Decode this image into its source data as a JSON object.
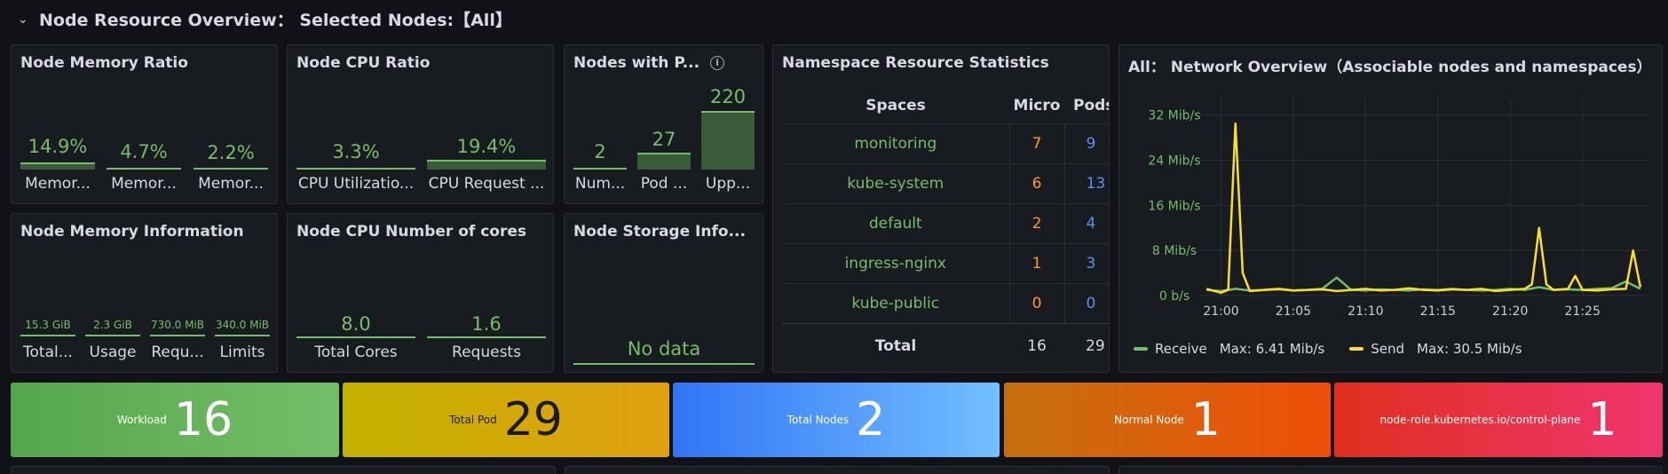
{
  "row": {
    "title": "Node Resource Overview： Selected Nodes:【All】"
  },
  "mem_ratio": {
    "title": "Node Memory Ratio",
    "gauges": [
      {
        "value": "14.9%",
        "label": "Memor...",
        "fill": 0.149
      },
      {
        "value": "4.7%",
        "label": "Memor...",
        "fill": 0.047
      },
      {
        "value": "2.2%",
        "label": "Memor...",
        "fill": 0.022
      }
    ]
  },
  "cpu_ratio": {
    "title": "Node CPU Ratio",
    "gauges": [
      {
        "value": "3.3%",
        "label": "CPU Utilizatio...",
        "fill": 0.033
      },
      {
        "value": "19.4%",
        "label": "CPU Request ...",
        "fill": 0.194
      }
    ]
  },
  "nodes_with_p": {
    "title": "Nodes with P...",
    "gauges": [
      {
        "value": "2",
        "label": "Num...",
        "fill": 0.01
      },
      {
        "value": "27",
        "label": "Pod ...",
        "fill": 0.123
      },
      {
        "value": "220",
        "label": "Upp...",
        "fill": 1.0
      }
    ]
  },
  "ns_stats": {
    "title": "Namespace Resource Statistics",
    "columns": [
      "Spaces",
      "Micro",
      "Pods"
    ],
    "rows": [
      {
        "space": "monitoring",
        "micro": "7",
        "pods": "9"
      },
      {
        "space": "kube-system",
        "micro": "6",
        "pods": "13"
      },
      {
        "space": "default",
        "micro": "2",
        "pods": "4"
      },
      {
        "space": "ingress-nginx",
        "micro": "1",
        "pods": "3"
      },
      {
        "space": "kube-public",
        "micro": "0",
        "pods": "0"
      }
    ],
    "total": {
      "label": "Total",
      "micro": "16",
      "pods": "29"
    }
  },
  "mem_info": {
    "title": "Node Memory Information",
    "gauges": [
      {
        "value": "15.3 GiB",
        "label": "Total..."
      },
      {
        "value": "2.3 GiB",
        "label": "Usage"
      },
      {
        "value": "730.0 MiB",
        "label": "Requ..."
      },
      {
        "value": "340.0 MiB",
        "label": "Limits"
      }
    ]
  },
  "cpu_cores": {
    "title": "Node CPU Number of cores",
    "gauges": [
      {
        "value": "8.0",
        "label": "Total Cores"
      },
      {
        "value": "1.6",
        "label": "Requests"
      }
    ]
  },
  "storage": {
    "title": "Node Storage Info...",
    "nodata": "No data"
  },
  "network": {
    "title": "All： Network Overview（Associable nodes and namespaces）",
    "legend": [
      {
        "name": "Receive",
        "max": "Max: 6.41 Mib/s",
        "color": "#73bf69"
      },
      {
        "name": "Send",
        "max": "Max: 30.5 Mib/s",
        "color": "#fade2a"
      }
    ]
  },
  "chart_data": {
    "type": "line",
    "title": "All： Network Overview（Associable nodes and namespaces）",
    "y_ticks": [
      "32 Mib/s",
      "24 Mib/s",
      "16 Mib/s",
      "8 Mib/s",
      "0 b/s"
    ],
    "x_ticks": [
      "21:00",
      "21:05",
      "21:10",
      "21:15",
      "21:20",
      "21:25"
    ],
    "ylim": [
      0,
      34
    ],
    "x_range_minutes": [
      -1.5,
      29.5
    ],
    "grid": true,
    "legend_position": "bottom",
    "series": [
      {
        "name": "Receive",
        "color": "#73bf69",
        "x": [
          -1,
          0,
          1,
          2,
          3,
          4,
          5,
          6,
          7,
          8,
          9,
          10,
          11,
          12,
          13,
          14,
          15,
          16,
          17,
          18,
          19,
          20,
          21,
          22,
          23,
          24,
          25,
          26,
          27,
          28,
          29
        ],
        "y": [
          1,
          0.8,
          1.2,
          0.9,
          1,
          1.1,
          0.9,
          1,
          1.2,
          3.2,
          1,
          0.9,
          1.1,
          1,
          0.9,
          1.1,
          1,
          1.2,
          1,
          0.9,
          1,
          1.2,
          1,
          1.5,
          1,
          1.1,
          1,
          1.2,
          1.3,
          2.5,
          1.2
        ]
      },
      {
        "name": "Send",
        "color": "#fade2a",
        "x": [
          -1,
          0,
          0.5,
          1,
          1.5,
          2,
          3,
          4,
          5,
          6,
          7,
          8,
          9,
          10,
          11,
          12,
          13,
          14,
          15,
          16,
          17,
          18,
          19,
          20,
          21,
          21.5,
          22,
          22.5,
          23,
          24,
          24.5,
          25,
          26,
          27,
          28,
          28.5,
          29
        ],
        "y": [
          1.2,
          0.5,
          1,
          30.5,
          4,
          0.8,
          1,
          1.2,
          0.9,
          1,
          1.1,
          0.8,
          1,
          1.2,
          0.9,
          1,
          1.3,
          1,
          0.9,
          1.1,
          1,
          1.2,
          0.8,
          1,
          1.2,
          2,
          12,
          2,
          1,
          1.2,
          3.5,
          1,
          0.9,
          1.1,
          1.2,
          8,
          1.5
        ]
      }
    ]
  },
  "stats": [
    {
      "label": "Workload",
      "value": "16",
      "from": "#56a64b",
      "to": "#73bf69"
    },
    {
      "label": "Total Pod",
      "value": "29",
      "from": "#c4b200",
      "to": "#e0a010"
    },
    {
      "label": "Total Nodes",
      "value": "2",
      "from": "#3274f6",
      "to": "#73bfff"
    },
    {
      "label": "Normal Node",
      "value": "1",
      "from": "#c4700f",
      "to": "#f04e0a"
    },
    {
      "label": "node-role.kubernetes.io/control-plane",
      "value": "1",
      "from": "#e02f1f",
      "to": "#f0356e"
    }
  ]
}
